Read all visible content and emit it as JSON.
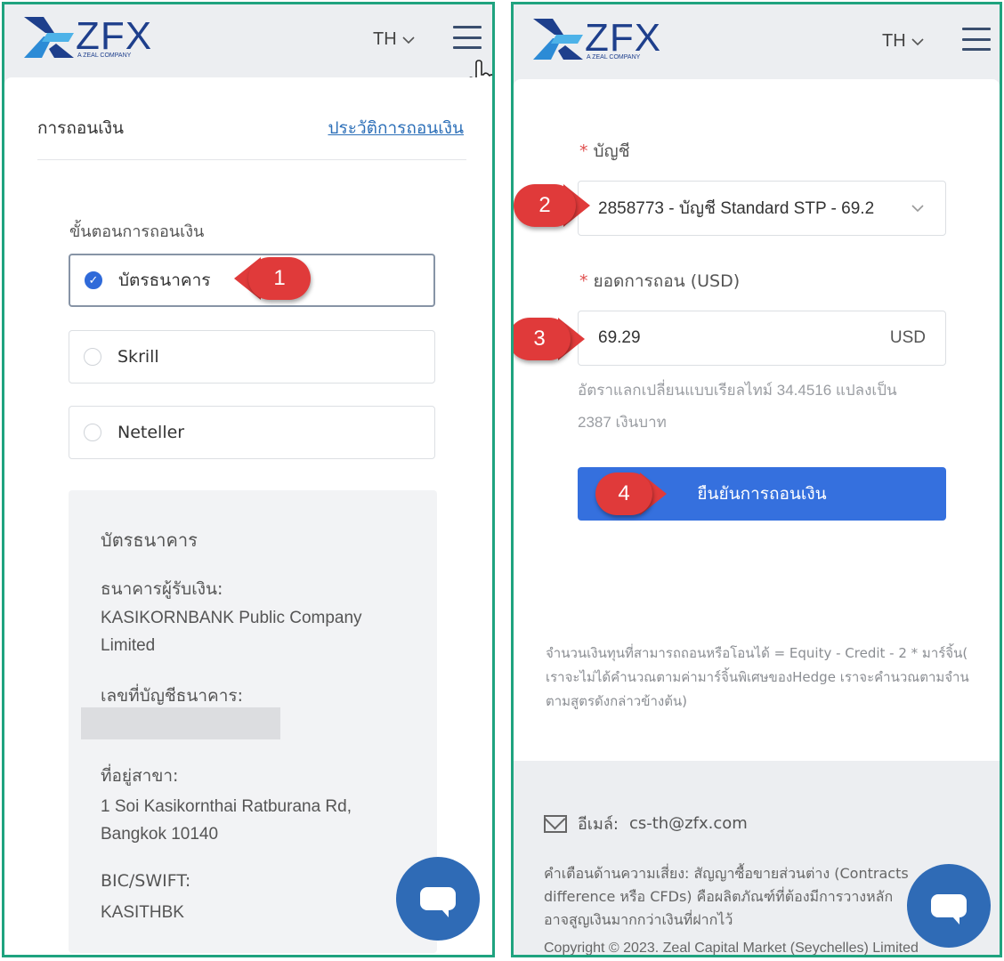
{
  "brand": {
    "logo_text": "ZFX",
    "logo_subtext": "A ZEAL COMPANY",
    "colors": {
      "brand_blue": "#1e3f8c",
      "accent_blue": "#3570de",
      "marker_red": "#e03a3a",
      "frame_green": "#1fa37f"
    }
  },
  "left_panel": {
    "header": {
      "language": "TH",
      "menu_icon": "hamburger-menu-icon",
      "pointer_icon": "hand-pointer-icon"
    },
    "title": "การถอนเงิน",
    "history_link": "ประวัติการถอนเงิน",
    "step_label": "ขั้นตอนการถอนเงิน",
    "options": [
      {
        "label": "บัตรธนาคาร",
        "selected": true
      },
      {
        "label": "Skrill",
        "selected": false
      },
      {
        "label": "Neteller",
        "selected": false
      }
    ],
    "marker": "1",
    "bank_info": {
      "heading": "บัตรธนาคาร",
      "beneficiary_label": "ธนาคารผู้รับเงิน:",
      "beneficiary_value": "KASIKORNBANK Public Company Limited",
      "account_label": "เลขที่บัญชีธนาคาร:",
      "branch_label": "ที่อยู่สาขา:",
      "branch_value": "1 Soi Kasikornthai Ratburana Rd, Bangkok 10140",
      "swift_label": "BIC/SWIFT:",
      "swift_value": "KASITHBK"
    }
  },
  "right_panel": {
    "header": {
      "language": "TH",
      "menu_icon": "hamburger-menu-icon"
    },
    "account_label": "บัญชี",
    "account_value": "2858773 - บัญชี Standard STP - 69.2",
    "amount_label": "ยอดการถอน (USD)",
    "amount_value": "69.29",
    "amount_currency": "USD",
    "rate_note_line1": "อัตราแลกเปลี่ยนแบบเรียลไทม์ 34.4516 แปลงเป็น",
    "rate_note_line2": "2387 เงินบาท",
    "confirm_button": "ยืนยันการถอนเงิน",
    "formula_line1": "จำนวนเงินทุนที่สามารถถอนหรือโอนได้ = Equity -  Credit - 2 * มาร์จิ้น(",
    "formula_line2": "เราจะไม่ได้คำนวณตามค่ามาร์จิ้นพิเศษของHedge เราจะคำนวณตามจำน",
    "formula_line3": "ตามสูตรดังกล่าวข้างต้น)",
    "markers": {
      "account": "2",
      "amount": "3",
      "confirm": "4"
    },
    "footer": {
      "email_label": "อีเมล์:",
      "email_value": "cs-th@zfx.com",
      "risk_line1": "คำเตือนด้านความเสี่ยง: สัญญาซื้อขายส่วนต่าง (Contracts",
      "risk_line2": "difference หรือ CFDs) คือผลิตภัณฑ์ที่ต้องมีการวางหลัก",
      "risk_line3": "อาจสูญเงินมากกว่าเงินที่ฝากไว้",
      "copyright": "Copyright © 2023. Zeal Capital Market (Seychelles) Limited"
    }
  }
}
